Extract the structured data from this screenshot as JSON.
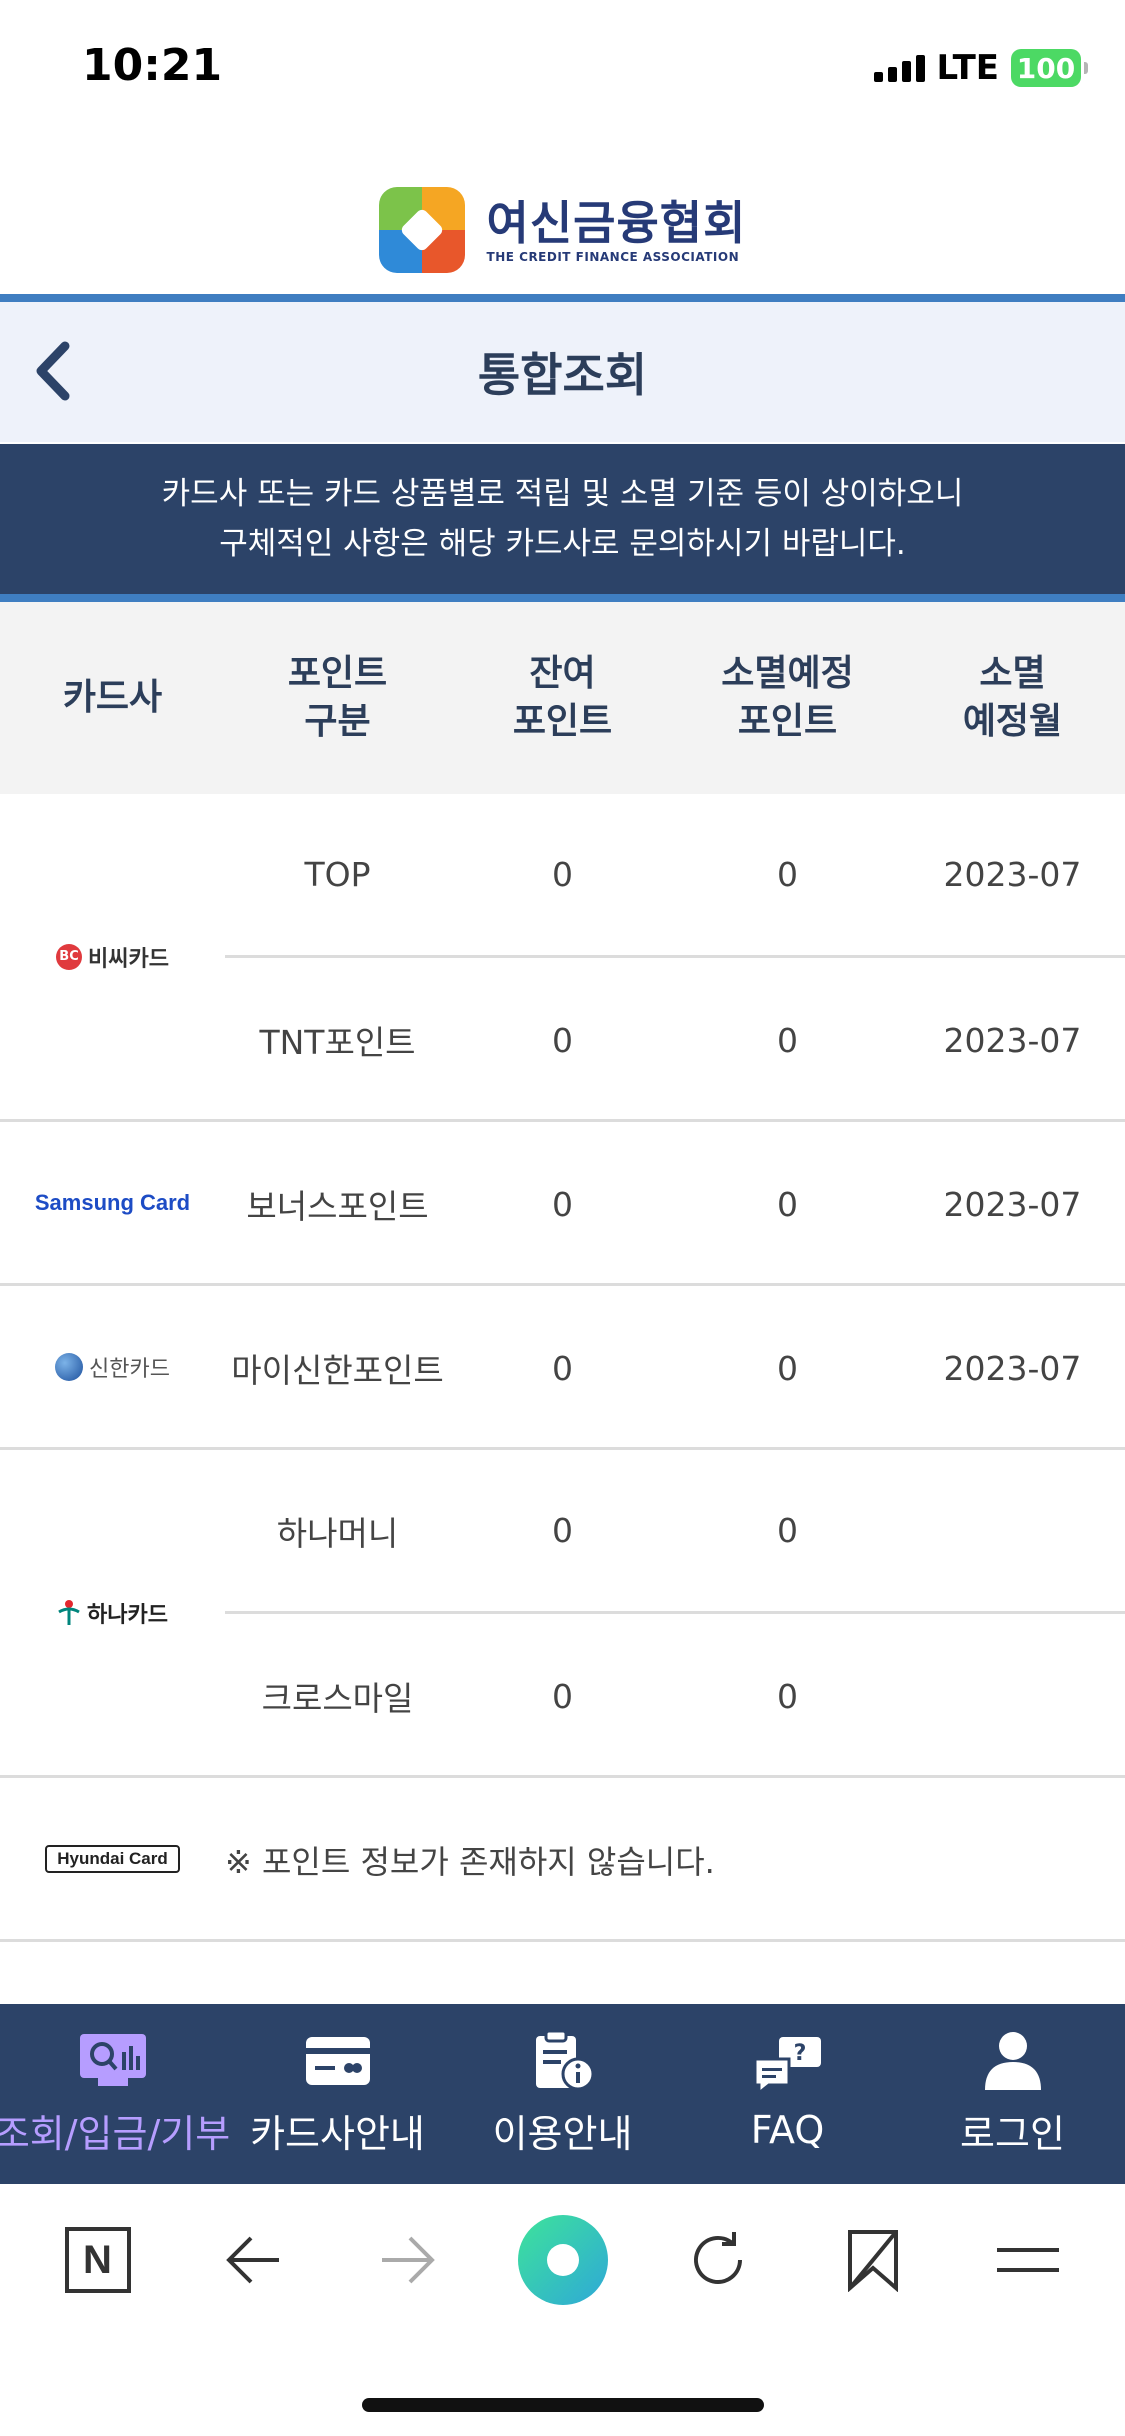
{
  "status_bar": {
    "time": "10:21",
    "network": "LTE",
    "battery": "100"
  },
  "header": {
    "logo_ko": "여신금융협회",
    "logo_en": "THE CREDIT FINANCE ASSOCIATION"
  },
  "title_bar": {
    "title": "통합조회"
  },
  "notice": {
    "line1": "카드사 또는 카드 상품별로 적립 및 소멸 기준 등이 상이하오니",
    "line2": "구체적인 사항은 해당 카드사로 문의하시기 바랍니다."
  },
  "table": {
    "headers": {
      "company": "카드사",
      "type_1": "포인트",
      "type_2": "구분",
      "balance_1": "잔여",
      "balance_2": "포인트",
      "expiring_1": "소멸예정",
      "expiring_2": "포인트",
      "month_1": "소멸",
      "month_2": "예정월"
    },
    "groups": [
      {
        "logo_text": "비씨카드",
        "logo_mark": "BC",
        "rows": [
          {
            "type": "TOP",
            "balance": "0",
            "expiring": "0",
            "month": "2023-07"
          },
          {
            "type": "TNT포인트",
            "balance": "0",
            "expiring": "0",
            "month": "2023-07"
          }
        ]
      },
      {
        "logo_text": "Samsung Card",
        "rows": [
          {
            "type": "보너스포인트",
            "balance": "0",
            "expiring": "0",
            "month": "2023-07"
          }
        ]
      },
      {
        "logo_text": "신한카드",
        "rows": [
          {
            "type": "마이신한포인트",
            "balance": "0",
            "expiring": "0",
            "month": "2023-07"
          }
        ]
      },
      {
        "logo_text": "하나카드",
        "rows": [
          {
            "type": "하나머니",
            "balance": "0",
            "expiring": "0",
            "month": ""
          },
          {
            "type": "크로스마일",
            "balance": "0",
            "expiring": "0",
            "month": ""
          }
        ]
      },
      {
        "logo_text": "Hyundai Card",
        "message": "※ 포인트 정보가 존재하지 않습니다."
      }
    ]
  },
  "tabbar": {
    "tabs": [
      {
        "label": "조회/입금/기부",
        "icon": "search-chart-icon"
      },
      {
        "label": "카드사안내",
        "icon": "card-icon"
      },
      {
        "label": "이용안내",
        "icon": "clipboard-info-icon"
      },
      {
        "label": "FAQ",
        "icon": "faq-chat-icon"
      },
      {
        "label": "로그인",
        "icon": "user-icon"
      }
    ],
    "active_color": "#b69dff"
  },
  "browser": {
    "home_label": "N"
  },
  "colors": {
    "navy": "#2c4368",
    "accent_blue": "#3f7ec1",
    "title_bg": "#eef2fa"
  }
}
